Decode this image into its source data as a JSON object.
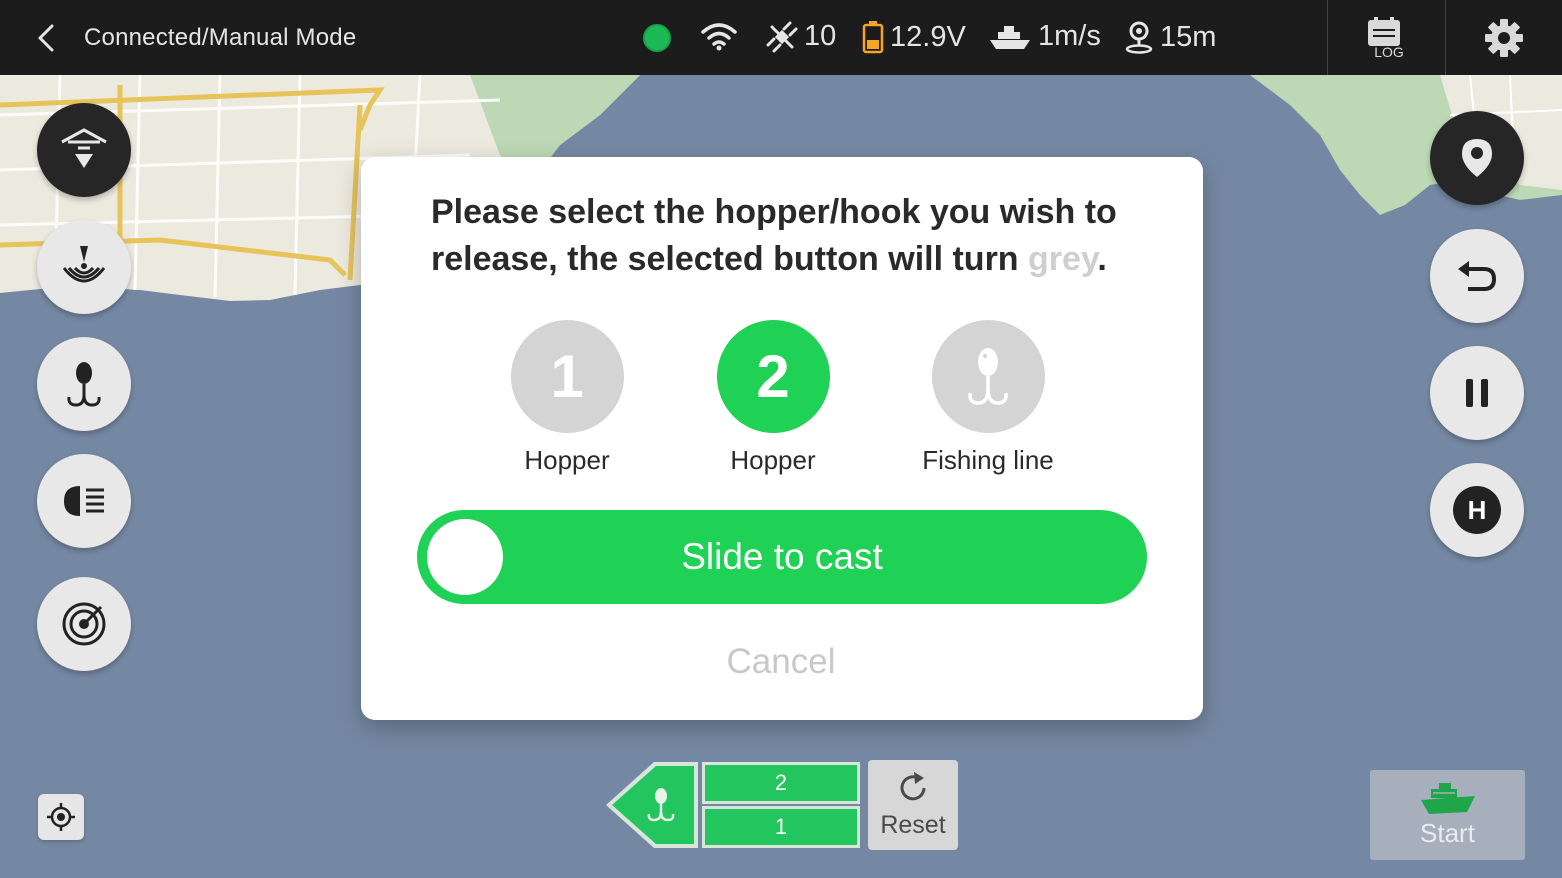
{
  "topbar": {
    "title": "Connected/Manual Mode",
    "status_color": "#1db954",
    "satellites": "10",
    "voltage": "12.9V",
    "speed": "1m/s",
    "distance": "15m",
    "log_label": "LOG"
  },
  "modal": {
    "message_before": "Please select the hopper/hook you wish to release, the selected button will turn ",
    "message_grey_word": "grey",
    "message_after": ".",
    "options": [
      {
        "number": "1",
        "label": "Hopper",
        "state": "grey"
      },
      {
        "number": "2",
        "label": "Hopper",
        "state": "green"
      },
      {
        "icon": "fishing-hook-icon",
        "label": "Fishing line",
        "state": "grey"
      }
    ],
    "slide_label": "Slide to cast",
    "cancel_label": "Cancel"
  },
  "left_tools": [
    "hopper-drop-icon",
    "sonar-icon",
    "fishing-hook-icon",
    "headlight-icon",
    "radar-icon"
  ],
  "right_tools": [
    "map-pin-icon",
    "return-icon",
    "pause-icon",
    "home-icon"
  ],
  "right_labels": {
    "home": "H"
  },
  "bottom": {
    "hopper_top": "2",
    "hopper_bottom": "1",
    "reset_label": "Reset",
    "start_label": "Start"
  },
  "colors": {
    "accent_green": "#1fd155",
    "topbar": "#1c1c1c",
    "water": "#7588a3",
    "land": "#ece9df"
  }
}
